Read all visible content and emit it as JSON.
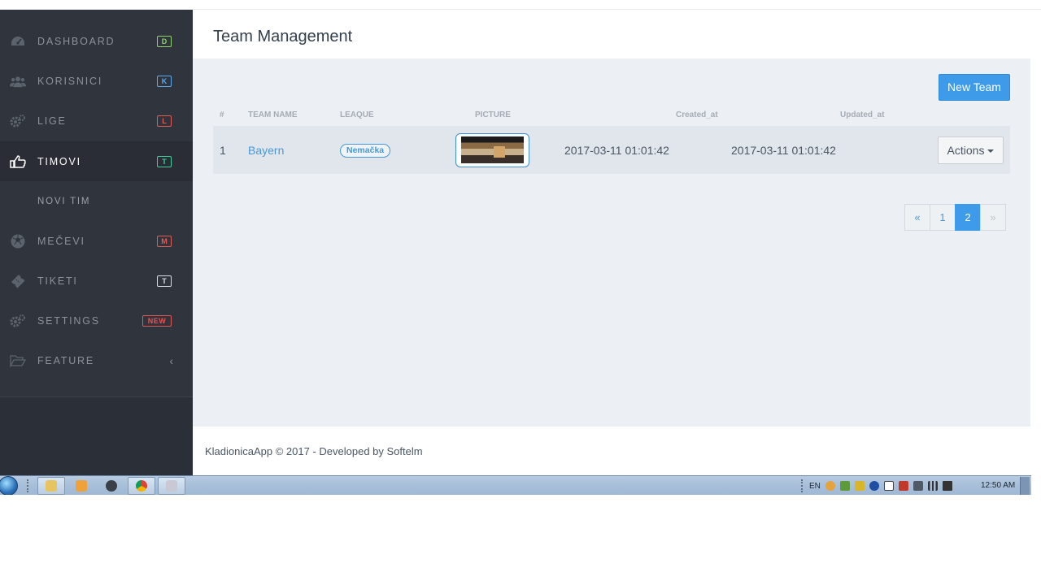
{
  "sidebar": {
    "items": [
      {
        "label": "DASHBOARD",
        "badge": "D",
        "icon": "dashboard-icon"
      },
      {
        "label": "KORISNICI",
        "badge": "K",
        "icon": "users-icon"
      },
      {
        "label": "LIGE",
        "badge": "L",
        "icon": "gears-icon"
      },
      {
        "label": "TIMOVI",
        "badge": "T",
        "icon": "hand-pointer-icon"
      },
      {
        "label": "NOVI TIM"
      },
      {
        "label": "MEČEVI",
        "badge": "M",
        "icon": "soccer-ball-icon"
      },
      {
        "label": "TIKETI",
        "badge": "T",
        "icon": "ticket-icon"
      },
      {
        "label": "SETTINGS",
        "badge": "NEW",
        "icon": "gears-icon"
      },
      {
        "label": "FEATURE",
        "chevron": "‹",
        "icon": "folder-open-icon"
      }
    ]
  },
  "page": {
    "title": "Team Management",
    "new_button": "New Team"
  },
  "table": {
    "headers": [
      "#",
      "TEAM NAME",
      "LEAQUE",
      "PICTURE",
      "Created_at",
      "Updated_at"
    ],
    "rows": [
      {
        "index": "1",
        "team_name": "Bayern",
        "league": "Nemačka",
        "created_at": "2017-03-11 01:01:42",
        "updated_at": "2017-03-11 01:01:42",
        "actions": "Actions"
      }
    ]
  },
  "pagination": {
    "prev": "«",
    "pages": [
      "1",
      "2"
    ],
    "active": "2",
    "next": "»"
  },
  "footer": {
    "text": "KladionicaApp © 2017 - Developed by Softelm"
  },
  "taskbar": {
    "language": "EN",
    "clock": "12:50 AM"
  },
  "colors": {
    "sidebar_bg": "#30343d",
    "accent": "#3d9be9",
    "content_bg": "#eceff3"
  }
}
